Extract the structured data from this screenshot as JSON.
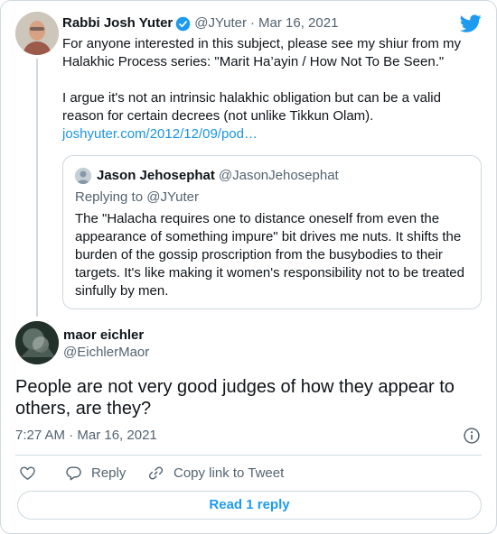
{
  "parent_tweet": {
    "display_name": "Rabbi Josh Yuter",
    "handle": "@JYuter",
    "separator": "·",
    "date": "Mar 16, 2021",
    "text": "For anyone interested in this subject, please see my shiur from my Halakhic Process series: \"Marit Ha’ayin / How Not To Be Seen.\"\n\nI argue it's not an intrinsic halakhic obligation but can be a valid reason for certain decrees (not unlike Tikkun Olam).",
    "link": "joshyuter.com/2012/12/09/pod…"
  },
  "quoted_tweet": {
    "display_name": "Jason Jehosephat",
    "handle": "@JasonJehosephat",
    "replying_to": "Replying to @JYuter",
    "text": "The \"Halacha requires one to distance oneself from even the appearance of something impure\" bit drives me nuts. It shifts the burden of the gossip proscription from the busybodies to their targets. It's like making it women's responsibility not to be treated sinfully by men."
  },
  "main_tweet": {
    "display_name": "maor eichler",
    "handle": "@EichlerMaor",
    "text": "People are not very good judges of how they appear to others, are they?",
    "timestamp": "7:27 AM · Mar 16, 2021"
  },
  "actions": {
    "reply_label": "Reply",
    "copy_link_label": "Copy link to Tweet",
    "read_replies_label": "Read 1 reply"
  },
  "icons": {
    "verified": "verified-badge-icon",
    "brand": "twitter-bird-icon",
    "info": "info-icon",
    "like": "heart-icon",
    "reply": "speech-bubble-icon",
    "copy_link": "link-icon"
  },
  "colors": {
    "accent": "#1d9bf0",
    "link": "#1b95e0",
    "secondary_text": "#536471",
    "border": "#cfd9de"
  }
}
